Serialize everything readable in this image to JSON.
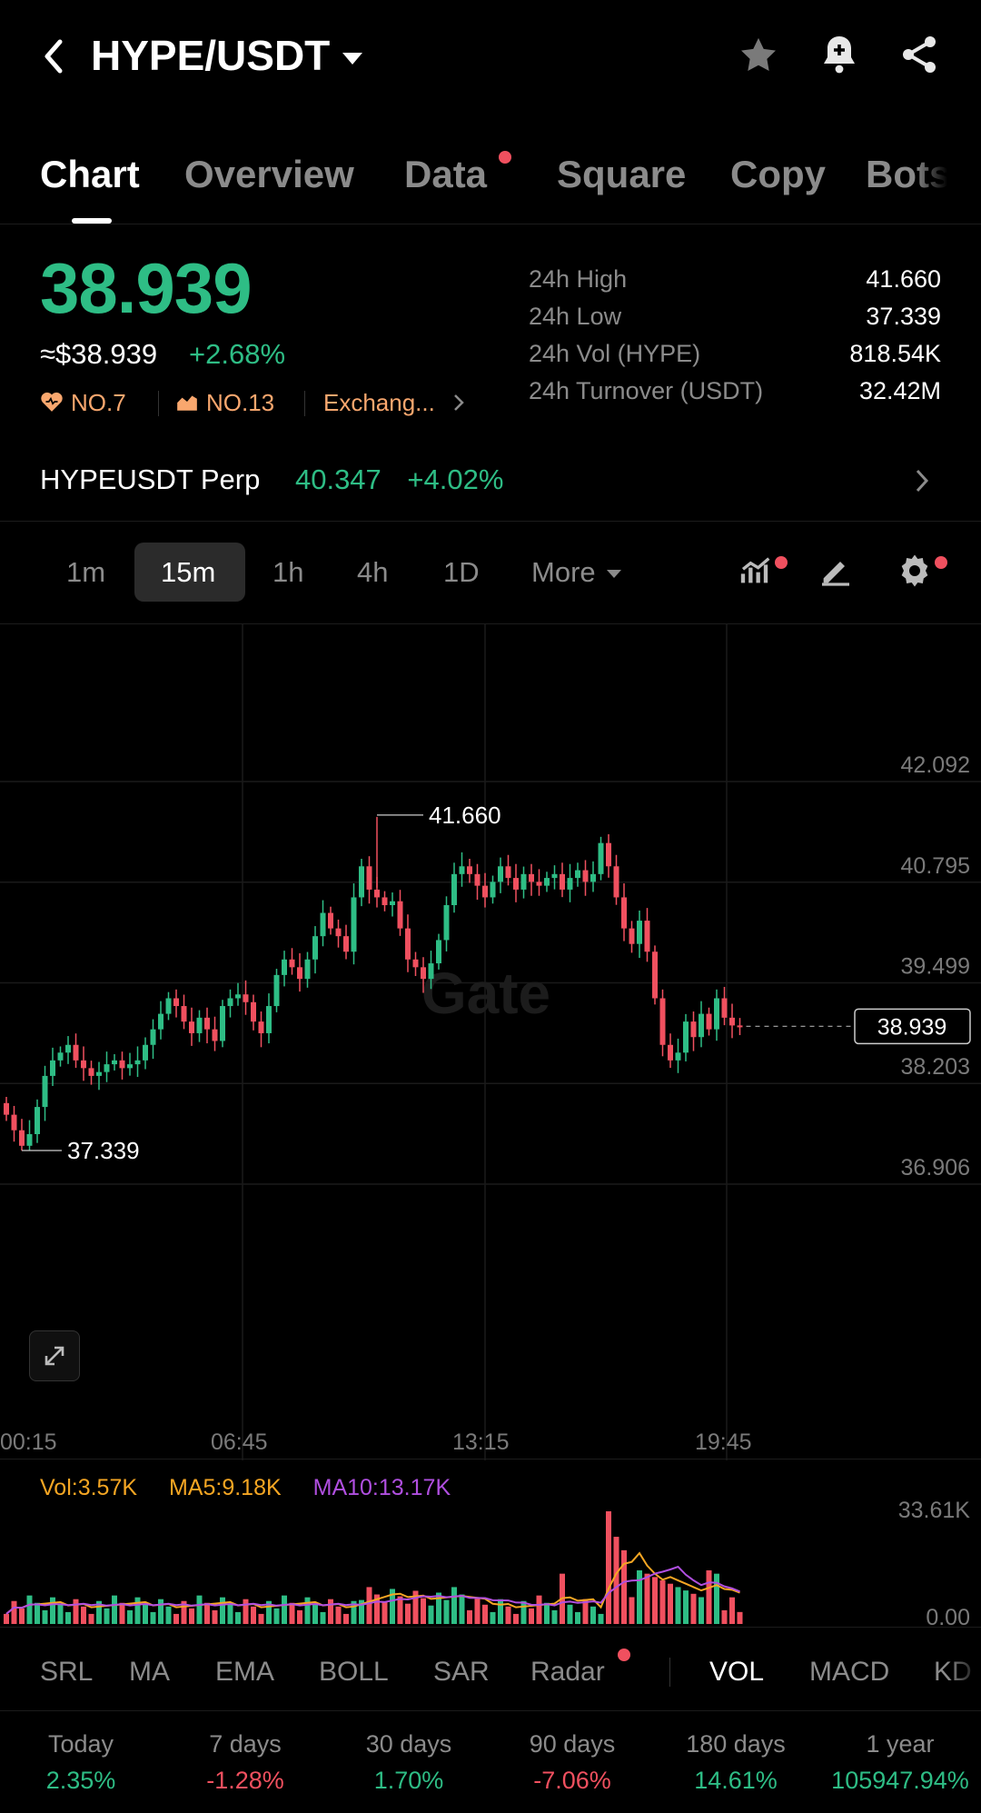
{
  "header": {
    "pair": "HYPE/USDT"
  },
  "tabs": [
    {
      "label": "Chart",
      "active": true
    },
    {
      "label": "Overview"
    },
    {
      "label": "Data",
      "dot": true
    },
    {
      "label": "Square"
    },
    {
      "label": "Copy"
    },
    {
      "label": "Bots"
    }
  ],
  "ticker": {
    "price": "38.939",
    "usd": "≈$38.939",
    "change": "+2.68%",
    "rank1": "NO.7",
    "rank2": "NO.13",
    "exchange": "Exchang...",
    "stats": [
      {
        "label": "24h High",
        "value": "41.660"
      },
      {
        "label": "24h Low",
        "value": "37.339"
      },
      {
        "label": "24h Vol (HYPE)",
        "value": "818.54K"
      },
      {
        "label": "24h Turnover (USDT)",
        "value": "32.42M"
      }
    ]
  },
  "perp": {
    "name": "HYPEUSDT Perp",
    "price": "40.347",
    "change": "+4.02%"
  },
  "timeframes": {
    "items": [
      "1m",
      "15m",
      "1h",
      "4h",
      "1D"
    ],
    "active": "15m",
    "more": "More"
  },
  "chart": {
    "watermark": "Gate",
    "y_ticks": [
      "42.092",
      "40.795",
      "39.499",
      "38.203",
      "36.906"
    ],
    "x_ticks": [
      "00:15",
      "06:45",
      "13:15",
      "19:45"
    ],
    "high_label": "41.660",
    "low_label": "37.339",
    "last_price": "38.939"
  },
  "volume": {
    "vol": "Vol:3.57K",
    "ma5": "MA5:9.18K",
    "ma10": "MA10:13.17K",
    "y_top": "33.61K",
    "y_bottom": "0.00"
  },
  "indicators": {
    "items": [
      "SRL",
      "MA",
      "EMA",
      "BOLL",
      "SAR",
      "Radar",
      "VOL",
      "MACD",
      "KD"
    ],
    "active": "VOL"
  },
  "performance": [
    {
      "label": "Today",
      "value": "2.35%",
      "sign": "pos"
    },
    {
      "label": "7 days",
      "value": "-1.28%",
      "sign": "neg"
    },
    {
      "label": "30 days",
      "value": "1.70%",
      "sign": "pos"
    },
    {
      "label": "90 days",
      "value": "-7.06%",
      "sign": "neg"
    },
    {
      "label": "180 days",
      "value": "14.61%",
      "sign": "pos"
    },
    {
      "label": "1 year",
      "value": "105947.94%",
      "sign": "pos"
    }
  ],
  "colors": {
    "up": "#2ebd85",
    "down": "#f0505f",
    "ma5": "#f5a623",
    "ma10": "#b04fe0",
    "accent": "#f9a76e"
  },
  "chart_data": {
    "type": "candlestick",
    "interval": "15m",
    "y_range": [
      36.906,
      42.092
    ],
    "x_ticks": [
      "00:15",
      "06:45",
      "13:15",
      "19:45"
    ],
    "high": 41.66,
    "low": 37.339,
    "last": 38.939,
    "close_path": [
      37.8,
      37.6,
      37.4,
      37.55,
      37.9,
      38.3,
      38.5,
      38.6,
      38.7,
      38.5,
      38.4,
      38.3,
      38.35,
      38.45,
      38.5,
      38.4,
      38.45,
      38.5,
      38.7,
      38.9,
      39.1,
      39.3,
      39.2,
      39.0,
      38.85,
      39.05,
      38.9,
      38.75,
      39.2,
      39.3,
      39.35,
      39.25,
      39.0,
      38.85,
      39.2,
      39.6,
      39.8,
      39.7,
      39.55,
      39.8,
      40.1,
      40.4,
      40.2,
      40.1,
      39.9,
      40.6,
      41.0,
      40.7,
      40.6,
      40.5,
      40.55,
      40.2,
      39.8,
      39.7,
      39.55,
      39.75,
      40.05,
      40.5,
      40.9,
      41.0,
      40.9,
      40.75,
      40.6,
      40.8,
      41.0,
      40.85,
      40.7,
      40.9,
      40.8,
      40.75,
      40.85,
      40.9,
      40.7,
      40.85,
      40.95,
      40.8,
      40.9,
      41.3,
      41.0,
      40.6,
      40.2,
      40.0,
      40.3,
      39.9,
      39.3,
      38.7,
      38.5,
      38.6,
      39.0,
      38.8,
      39.1,
      38.9,
      39.3,
      39.05,
      38.95,
      38.939
    ],
    "volume_y_range": [
      0,
      33.61
    ]
  }
}
